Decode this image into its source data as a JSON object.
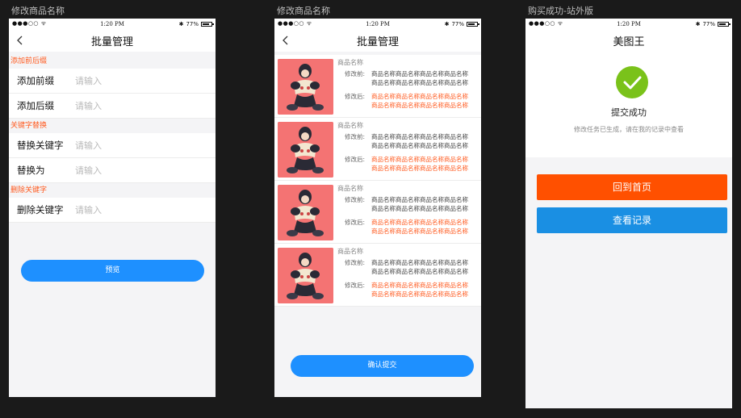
{
  "frames": [
    {
      "title": "修改商品名称"
    },
    {
      "title": "修改商品名称"
    },
    {
      "title": "购买成功-站外版"
    }
  ],
  "status": {
    "carrier": "●●●○○",
    "time": "1:20 PM",
    "battery": "77%"
  },
  "screen1": {
    "nav_title": "批量管理",
    "sections": [
      {
        "label": "添加前后缀"
      },
      {
        "label": "关键字替换"
      },
      {
        "label": "删除关键字"
      }
    ],
    "rows": [
      {
        "label": "添加前缀",
        "placeholder": "请输入"
      },
      {
        "label": "添加后缀",
        "placeholder": "请输入"
      },
      {
        "label": "替换关键字",
        "placeholder": "请输入"
      },
      {
        "label": "替换为",
        "placeholder": "请输入"
      },
      {
        "label": "删除关键字",
        "placeholder": "请输入"
      }
    ],
    "preview_button": "预览"
  },
  "screen2": {
    "nav_title": "批量管理",
    "products": [
      {
        "name": "商品名称",
        "before_label": "修改前:",
        "before_line1": "商品名称商品名称商品名称商品名称",
        "before_line2": "商品名称商品名称商品名称商品名称",
        "after_label": "修改后:",
        "after_line1": "商品名称商品名称商品名称商品名称",
        "after_line2": "商品名称商品名称商品名称商品名称"
      },
      {
        "name": "商品名称",
        "before_label": "修改前:",
        "before_line1": "商品名称商品名称商品名称商品名称",
        "before_line2": "商品名称商品名称商品名称商品名称",
        "after_label": "修改后:",
        "after_line1": "商品名称商品名称商品名称商品名称",
        "after_line2": "商品名称商品名称商品名称商品名称"
      },
      {
        "name": "商品名称",
        "before_label": "修改前:",
        "before_line1": "商品名称商品名称商品名称商品名称",
        "before_line2": "商品名称商品名称商品名称商品名称",
        "after_label": "修改后:",
        "after_line1": "商品名称商品名称商品名称商品名称",
        "after_line2": "商品名称商品名称商品名称商品名称"
      },
      {
        "name": "商品名称",
        "before_label": "修改前:",
        "before_line1": "商品名称商品名称商品名称商品名称",
        "before_line2": "商品名称商品名称商品名称商品名称",
        "after_label": "修改后:",
        "after_line1": "商品名称商品名称商品名称商品名称",
        "after_line2": "商品名称商品名称商品名称商品名称"
      }
    ],
    "confirm_button": "确认提交"
  },
  "screen3": {
    "nav_title": "美图王",
    "success_title": "提交成功",
    "success_desc": "修改任务已生成，请在我的记录中查看",
    "home_button": "回到首页",
    "records_button": "查看记录"
  },
  "colors": {
    "accent_orange": "#ff5a1f",
    "primary_blue": "#1e90ff",
    "success_green": "#7ac21a",
    "home_button": "#ff5000",
    "records_button": "#1a8fe3"
  },
  "icons": [
    "back-arrow-icon",
    "wifi-icon",
    "bluetooth-icon",
    "battery-icon",
    "checkmark-icon",
    "product-image"
  ]
}
